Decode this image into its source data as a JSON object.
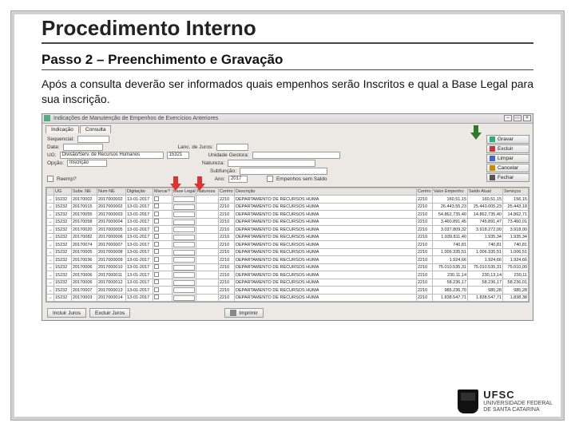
{
  "slide": {
    "title": "Procedimento Interno",
    "subtitle": "Passo 2 – Preenchimento e Gravação",
    "description": "Após a consulta deverão ser informados quais empenhos serão Inscritos e qual a Base Legal para sua inscrição."
  },
  "window": {
    "title": "Indicações de Manutenção de Empenhos de Exercícios Anteriores",
    "tabs": [
      "Indicação",
      "Consulta"
    ],
    "fields": {
      "sequencial": "Sequencial:",
      "data": "Data:",
      "lanc_juros": "Lanc. de Juros:",
      "ug": "UG:",
      "ug_value": "Divisão/Serv. de Recursos Humanos",
      "ug_code": "15321",
      "unidade": "Unidade Gestora:",
      "opcao": "Opção:",
      "opcao_value": "Inscrição",
      "natureza": "Natureza:",
      "subfuncao": "Subfunção:",
      "ano": "Ano:",
      "ano_value": "2017",
      "empenhos_sem": "Empenhos sem Saldo",
      "reemp": "Reemp?"
    },
    "buttons": {
      "gravar": "Gravar",
      "excluir": "Excluir",
      "limpar": "Limpar",
      "cancelar": "Cancelar",
      "fechar": "Fechar"
    },
    "bottom_buttons": {
      "incluir_juros": "Incluir Juros",
      "excluir_juros": "Excluir Juros",
      "imprimir": "Imprimir"
    }
  },
  "table": {
    "headers": [
      "",
      "UG",
      "Subv. NE",
      "Num NE",
      "Digitação",
      "Marcar?",
      "Base Legal",
      "Natureza",
      "Centro",
      "Descrição",
      "Centro",
      "Valor Empenho",
      "Saldo Atual",
      "Serviços"
    ],
    "rows": [
      {
        "ug": "15232",
        "subv": "20170002",
        "ne": "2017000002",
        "dig": "13-01-2017",
        "nat": "",
        "cen": "2210",
        "desc": "DEPARTAMENTO DE RECURSOS HUMA",
        "cen2": "2210",
        "emp": "160,51,15",
        "saldo": "160,51,15",
        "serv": "156,15"
      },
      {
        "ug": "15232",
        "subv": "20170015",
        "ne": "2017000002",
        "dig": "13-01-2017",
        "nat": "",
        "cen": "2210",
        "desc": "DEPARTAMENTO DE RECURSOS HUMA",
        "cen2": "2210",
        "emp": "26.443,55,23",
        "saldo": "25.443.005,23",
        "serv": "25.443,18"
      },
      {
        "ug": "15232",
        "subv": "20170055",
        "ne": "2017000003",
        "dig": "13-01-2017",
        "nat": "",
        "cen": "2210",
        "desc": "DEPARTAMENTO DE RECURSOS HUMA",
        "cen2": "2210",
        "emp": "54.862,735,40",
        "saldo": "14.862,735,40",
        "serv": "14.862,71"
      },
      {
        "ug": "15232",
        "subv": "20170058",
        "ne": "2017000004",
        "dig": "13-01-2017",
        "nat": "",
        "cen": "2210",
        "desc": "DEPARTAMENTO DE RECURSOS HUMA",
        "cen2": "2210",
        "emp": "3.460.891,45",
        "saldo": "745.891,47",
        "serv": "73.460,01"
      },
      {
        "ug": "15232",
        "subv": "20170020",
        "ne": "2017000005",
        "dig": "13-01-2017",
        "nat": "",
        "cen": "2210",
        "desc": "DEPARTAMENTO DE RECURSOS HUMA",
        "cen2": "2210",
        "emp": "3.037.809,32",
        "saldo": "3.918.272,00",
        "serv": "3.918,00"
      },
      {
        "ug": "15232",
        "subv": "20170082",
        "ne": "2017000006",
        "dig": "13-01-2017",
        "nat": "",
        "cen": "2210",
        "desc": "DEPARTAMENTO DE RECURSOS HUMA",
        "cen2": "2210",
        "emp": "1.039.811,40",
        "saldo": "1.935,34",
        "serv": "1.935,34"
      },
      {
        "ug": "15232",
        "subv": "20170074",
        "ne": "2017000007",
        "dig": "13-01-2017",
        "nat": "",
        "cen": "2210",
        "desc": "DEPARTAMENTO DE RECURSOS HUMA",
        "cen2": "2210",
        "emp": "740,81",
        "saldo": "740,81",
        "serv": "740,81"
      },
      {
        "ug": "15232",
        "subv": "20170005",
        "ne": "2017000008",
        "dig": "13-01-2017",
        "nat": "",
        "cen": "2210",
        "desc": "DEPARTAMENTO DE RECURSOS HUMA",
        "cen2": "2210",
        "emp": "1.006.335,51",
        "saldo": "1.006.335,51",
        "serv": "1.006,51"
      },
      {
        "ug": "15232",
        "subv": "20170036",
        "ne": "2017000009",
        "dig": "13-01-2017",
        "nat": "",
        "cen": "2210",
        "desc": "DEPARTAMENTO DE RECURSOS HUMA",
        "cen2": "2210",
        "emp": "1.924,66",
        "saldo": "1.924,66",
        "serv": "1.924,66"
      },
      {
        "ug": "15232",
        "subv": "20170006",
        "ne": "2017000010",
        "dig": "13-01-2017",
        "nat": "",
        "cen": "2210",
        "desc": "DEPARTAMENTO DE RECURSOS HUMA",
        "cen2": "2210",
        "emp": "75.010.535,31",
        "saldo": "75.010.535,31",
        "serv": "75.010,00"
      },
      {
        "ug": "15232",
        "subv": "20170006",
        "ne": "2017000011",
        "dig": "13-01-2017",
        "nat": "",
        "cen": "2210",
        "desc": "DEPARTAMENTO DE RECURSOS HUMA",
        "cen2": "2210",
        "emp": "230,11,14",
        "saldo": "230,13,14",
        "serv": "230,11"
      },
      {
        "ug": "15232",
        "subv": "20170006",
        "ne": "2017000012",
        "dig": "13-01-2017",
        "nat": "",
        "cen": "2210",
        "desc": "DEPARTAMENTO DE RECURSOS HUMA",
        "cen2": "2210",
        "emp": "58.236,17",
        "saldo": "58.236,17",
        "serv": "58.236,01"
      },
      {
        "ug": "15232",
        "subv": "20170007",
        "ne": "2017000013",
        "dig": "13-01-2017",
        "nat": "",
        "cen": "2210",
        "desc": "DEPARTAMENTO DE RECURSOS HUMA",
        "cen2": "2210",
        "emp": "985.236,70",
        "saldo": "985,28",
        "serv": "985,28"
      },
      {
        "ug": "15232",
        "subv": "20170003",
        "ne": "2017000014",
        "dig": "13-01-2017",
        "nat": "",
        "cen": "2210",
        "desc": "DEPARTAMENTO DE RECURSOS HUMA",
        "cen2": "2210",
        "emp": "1.838.547,71",
        "saldo": "1.838.547,71",
        "serv": "1.838,38"
      }
    ]
  },
  "footer": {
    "logo_abbr": "UFSC",
    "logo_line1": "UNIVERSIDADE FEDERAL",
    "logo_line2": "DE SANTA CATARINA"
  },
  "arrows": {
    "color_red": "#d33",
    "color_green": "#2a7a2a"
  }
}
